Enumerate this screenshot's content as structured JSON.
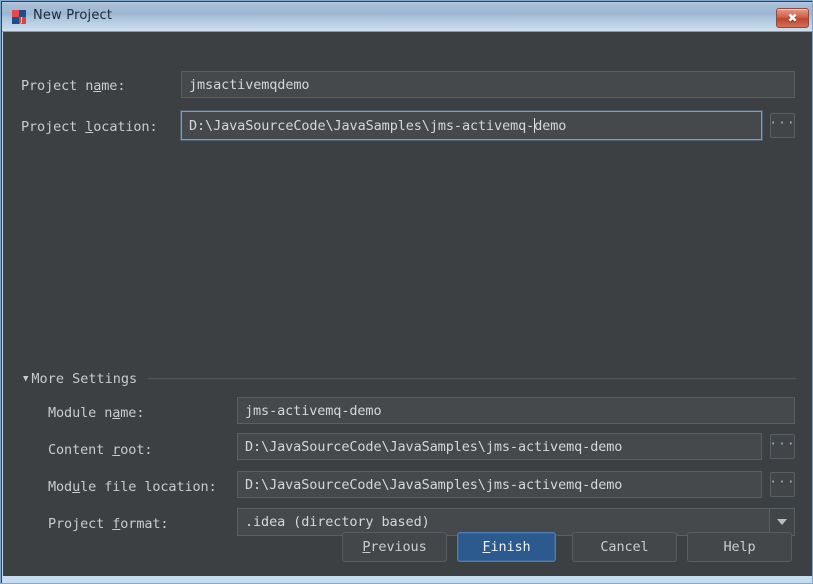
{
  "window": {
    "title": "New Project",
    "icon": "intellij-idea-icon",
    "close_label": "✖",
    "colors": {
      "background": "#3c4043",
      "field_background": "#45494c",
      "field_border": "#5a5f63",
      "focus_border": "#6f9fd0",
      "text": "#d4d8da",
      "label_text": "#c8ccce",
      "titlebar_text": "#1b2838",
      "default_button_bg": "#2d5a8e",
      "close_button_bg": "#bf4530"
    }
  },
  "form": {
    "project_name": {
      "label_before": "Project n",
      "label_mnemonic": "a",
      "label_after": "me:",
      "value": "jmsactivemqdemo",
      "placeholder": ""
    },
    "project_location": {
      "label_before": "Project ",
      "label_mnemonic": "l",
      "label_after": "ocation:",
      "value_before_caret": "D:\\JavaSourceCode\\JavaSamples\\jms-activemq-",
      "value_after_caret": "demo",
      "full_value": "D:\\JavaSourceCode\\JavaSamples\\jms-activemq-demo",
      "browse_label": "···",
      "focused": true
    }
  },
  "more_settings": {
    "arrow": "▼",
    "label_before": "Mor",
    "label_mnemonic": "e",
    "label_after": " Settings",
    "expanded": true,
    "fields": {
      "module_name": {
        "label_before": "Module n",
        "label_mnemonic": "a",
        "label_after": "me:",
        "value": "jms-activemq-demo"
      },
      "content_root": {
        "label_before": "Content ",
        "label_mnemonic": "r",
        "label_after": "oot:",
        "value": "D:\\JavaSourceCode\\JavaSamples\\jms-activemq-demo",
        "browse_label": "···"
      },
      "module_file_location": {
        "label_before": "Mod",
        "label_mnemonic": "u",
        "label_after": "le file location:",
        "value": "D:\\JavaSourceCode\\JavaSamples\\jms-activemq-demo",
        "browse_label": "···"
      },
      "project_format": {
        "label_before": "Project ",
        "label_mnemonic": "f",
        "label_after": "ormat:",
        "value": ".idea (directory based)",
        "options": [
          ".idea (directory based)"
        ]
      }
    }
  },
  "buttons": {
    "previous": {
      "before": "",
      "mnemonic": "P",
      "after": "revious"
    },
    "finish": {
      "before": "",
      "mnemonic": "F",
      "after": "inish",
      "is_default": true
    },
    "cancel": {
      "before": "Cancel",
      "mnemonic": "",
      "after": ""
    },
    "help": {
      "before": "Help",
      "mnemonic": "",
      "after": ""
    }
  }
}
